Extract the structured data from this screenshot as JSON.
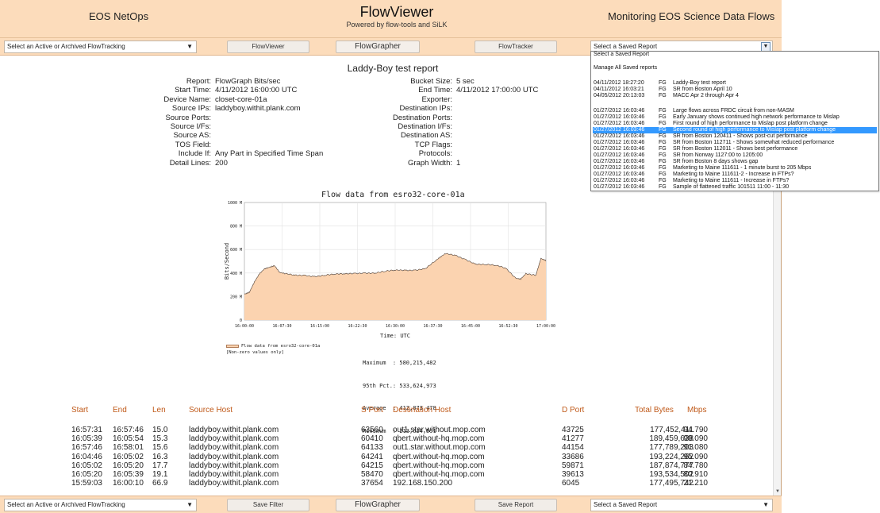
{
  "header": {
    "left_title": "EOS NetOps",
    "center_title": "FlowViewer",
    "center_subtitle": "Powered by flow-tools and SiLK",
    "right_title": "Monitoring EOS Science Data Flows"
  },
  "top_toolbar": {
    "tracking_select": "Select an Active or Archived FlowTracking",
    "btn_flowviewer": "FlowViewer",
    "btn_flowgrapher": "FlowGrapher",
    "btn_flowtracker": "FlowTracker",
    "saved_report_select": "Select a Saved Report"
  },
  "bottom_toolbar": {
    "tracking_select": "Select an Active or Archived FlowTracking",
    "btn_save_filter": "Save Filter",
    "btn_flowgrapher": "FlowGrapher",
    "btn_save_report": "Save Report",
    "saved_report_select": "Select a Saved Report"
  },
  "report": {
    "title": "Laddy-Boy test report",
    "left_params": [
      {
        "label": "Report:",
        "value": "FlowGraph Bits/sec"
      },
      {
        "label": "Start Time:",
        "value": "4/11/2012 16:00:00 UTC"
      },
      {
        "label": "Device Name:",
        "value": "closet-core-01a"
      },
      {
        "label": "Source IPs:",
        "value": "laddyboy.withit.plank.com"
      },
      {
        "label": "Source Ports:",
        "value": ""
      },
      {
        "label": "Source I/Fs:",
        "value": ""
      },
      {
        "label": "Source AS:",
        "value": ""
      },
      {
        "label": "TOS Field:",
        "value": ""
      },
      {
        "label": "Include If:",
        "value": "Any Part in Specified Time Span"
      },
      {
        "label": "Detail Lines:",
        "value": "200"
      }
    ],
    "right_params": [
      {
        "label": "Bucket Size:",
        "value": "5 sec"
      },
      {
        "label": "End Time:",
        "value": "4/11/2012 17:00:00 UTC"
      },
      {
        "label": "Exporter:",
        "value": ""
      },
      {
        "label": "Destination IPs:",
        "value": ""
      },
      {
        "label": "Destination Ports:",
        "value": ""
      },
      {
        "label": "Destination I/Fs:",
        "value": ""
      },
      {
        "label": "Destination AS:",
        "value": ""
      },
      {
        "label": "TCP Flags:",
        "value": ""
      },
      {
        "label": "Protocols:",
        "value": ""
      },
      {
        "label": "Graph Width:",
        "value": "1"
      }
    ]
  },
  "chart_data": {
    "type": "area",
    "title": "Flow data from esro32-core-01a",
    "xlabel": "Time: UTC",
    "ylabel": "Bits/Second",
    "x_ticks": [
      "16:00:00",
      "16:07:30",
      "16:15:00",
      "16:22:30",
      "16:30:00",
      "16:37:30",
      "16:45:00",
      "16:52:30",
      "17:00:00"
    ],
    "y_ticks": [
      "0",
      "200 M",
      "400 M",
      "600 M",
      "800 M",
      "1000 M"
    ],
    "ylim": [
      0,
      1000
    ],
    "grid": true,
    "fill_color": "#fbd3b0",
    "line_color": "#4a3a30",
    "series": [
      {
        "name": "Flow data from esro32-core-01a",
        "x_minutes": [
          0,
          1,
          2,
          3,
          4,
          5,
          6,
          7,
          8,
          10,
          12,
          14,
          16,
          18,
          20,
          22,
          24,
          26,
          28,
          30,
          32,
          34,
          36,
          38,
          39,
          40,
          42,
          44,
          46,
          48,
          50,
          52,
          54,
          55,
          56,
          58,
          59,
          60
        ],
        "y_mbps": [
          220,
          240,
          330,
          400,
          440,
          450,
          460,
          400,
          390,
          380,
          385,
          375,
          380,
          385,
          390,
          400,
          405,
          400,
          410,
          420,
          425,
          430,
          440,
          500,
          530,
          560,
          550,
          520,
          480,
          470,
          460,
          440,
          360,
          355,
          400,
          380,
          520,
          500
        ]
      }
    ],
    "legend": [
      "Flow data from esro32-core-01a",
      "[Non-zero values only]"
    ],
    "stats": {
      "maximum": "580,215,482",
      "pct95": "533,624,973",
      "average": "412,873,478",
      "minimum": "213,624,591"
    }
  },
  "stats_labels": {
    "maximum": "Maximum  :",
    "pct95": "95th Pct.:",
    "average": "Average  :",
    "minimum": "Minimum  :"
  },
  "table": {
    "headers": [
      "Start",
      "End",
      "Len",
      "Source Host",
      "S Port",
      "Destination Host",
      "D Port",
      "Total Bytes",
      "Mbps"
    ],
    "rows": [
      [
        "16:57:31",
        "16:57:46",
        "15.0",
        "laddyboy.withit.plank.com",
        "63560",
        "out1.star.without.mop.com",
        "43725",
        "177,452,411",
        "94.790"
      ],
      [
        "16:05:39",
        "16:05:54",
        "15.3",
        "laddyboy.withit.plank.com",
        "60410",
        "qbert.without-hq.mop.com",
        "41277",
        "189,459,638",
        "99.090"
      ],
      [
        "16:57:46",
        "16:58:01",
        "15.6",
        "laddyboy.withit.plank.com",
        "64133",
        "out1.star.without.mop.com",
        "44154",
        "177,789,203",
        "91.080"
      ],
      [
        "16:04:46",
        "16:05:02",
        "16.3",
        "laddyboy.withit.plank.com",
        "64241",
        "qbert.without-hq.mop.com",
        "33686",
        "193,224,262",
        "95.090"
      ],
      [
        "16:05:02",
        "16:05:20",
        "17.7",
        "laddyboy.withit.plank.com",
        "64215",
        "qbert.without-hq.mop.com",
        "59871",
        "187,874,777",
        "84.780"
      ],
      [
        "16:05:20",
        "16:05:39",
        "19.1",
        "laddyboy.withit.plank.com",
        "58470",
        "qbert.without-hq.mop.com",
        "39613",
        "193,534,502",
        "80.910"
      ],
      [
        "15:59:03",
        "16:00:10",
        "66.9",
        "laddyboy.withit.plank.com",
        "37654",
        "192.168.150.200",
        "6045",
        "177,495,742",
        "21.210"
      ]
    ]
  },
  "dropdown": {
    "items": [
      {
        "ts": "Select a Saved Report",
        "type": "",
        "name": "",
        "header": true
      },
      {
        "ts": "Manage All Saved reports",
        "type": "",
        "name": "",
        "header": true
      },
      {
        "ts": "04/11/2012 18:27:20",
        "type": "FG",
        "name": "Laddy-Boy test report"
      },
      {
        "ts": "04/11/2012 16:03:21",
        "type": "FG",
        "name": "SR from Boston April 10"
      },
      {
        "ts": "04/05/2012 20:13:03",
        "type": "FG",
        "name": "MACC Apr 2 through Apr 4"
      },
      {
        "ts": "01/27/2012 16:03:46",
        "type": "FG",
        "name": "Large flows across FRDC circuit from non-MASM"
      },
      {
        "ts": "01/27/2012 16:03:46",
        "type": "FG",
        "name": "Early January shows continued high network performance to Mislap"
      },
      {
        "ts": "01/27/2012 16:03:46",
        "type": "FG",
        "name": "First round of high performance to Mislap post platform change"
      },
      {
        "ts": "01/27/2012 16:03:46",
        "type": "FG",
        "name": "Second round of high performance to Mislap post platform change",
        "selected": true
      },
      {
        "ts": "01/27/2012 16:03:46",
        "type": "FG",
        "name": "SR from Boston 120411 - Shows post-cut performance"
      },
      {
        "ts": "01/27/2012 16:03:46",
        "type": "FG",
        "name": "SR from Boston 112711 - Shows somewhat reduced performance"
      },
      {
        "ts": "01/27/2012 16:03:46",
        "type": "FG",
        "name": "SR from Boston 112011 - Shows best performance"
      },
      {
        "ts": "01/27/2012 16:03:46",
        "type": "FG",
        "name": "SR from Norway 1127:00 to 1205:00"
      },
      {
        "ts": "01/27/2012 16:03:46",
        "type": "FG",
        "name": "SR from Boston 8 days shows gap"
      },
      {
        "ts": "01/27/2012 16:03:46",
        "type": "FG",
        "name": "Marketing to Maine 111611 - 1 minute burst to 205 Mbps"
      },
      {
        "ts": "01/27/2012 16:03:46",
        "type": "FG",
        "name": "Marketing to Maine 111611-2 - Increase in FTPs?"
      },
      {
        "ts": "01/27/2012 16:03:46",
        "type": "FG",
        "name": "Marketing to Maine 111611 - Increase in FTPs?"
      },
      {
        "ts": "01/27/2012 16:03:46",
        "type": "FG",
        "name": "Sample of flattened traffic 101511 11:00 - 11:30"
      }
    ]
  }
}
